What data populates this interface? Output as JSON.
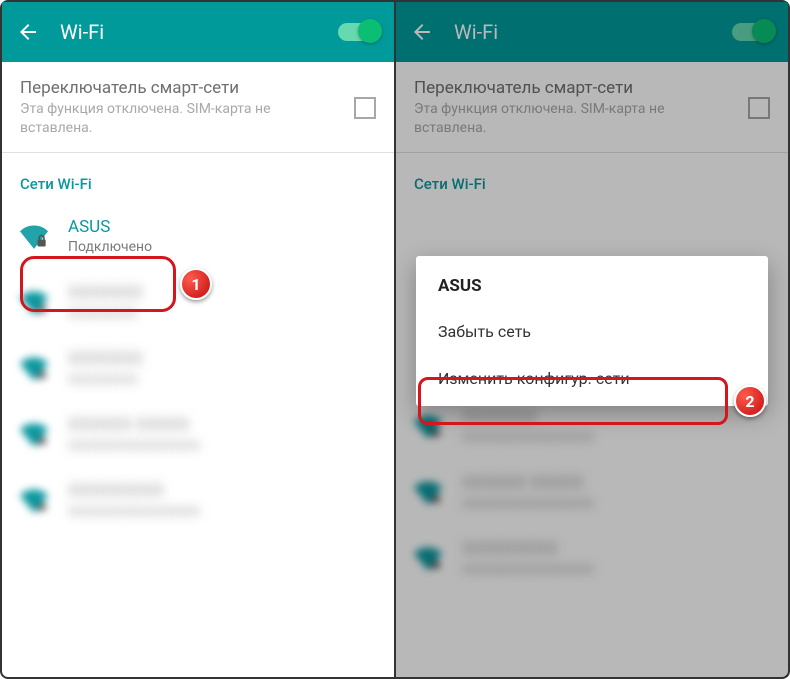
{
  "appbar": {
    "title": "Wi-Fi"
  },
  "smart": {
    "title": "Переключатель смарт-сети",
    "sub": "Эта функция отключена. SIM-карта не вставлена."
  },
  "section_label": "Сети Wi-Fi",
  "network": {
    "name": "ASUS",
    "status": "Подключено"
  },
  "popup": {
    "title": "ASUS",
    "forget": "Забыть сеть",
    "modify": "Изменить конфигур. сети"
  },
  "badges": {
    "one": "1",
    "two": "2"
  },
  "colors": {
    "accent": "#009a9a",
    "link": "#0a98a0",
    "danger": "#d4161e"
  }
}
